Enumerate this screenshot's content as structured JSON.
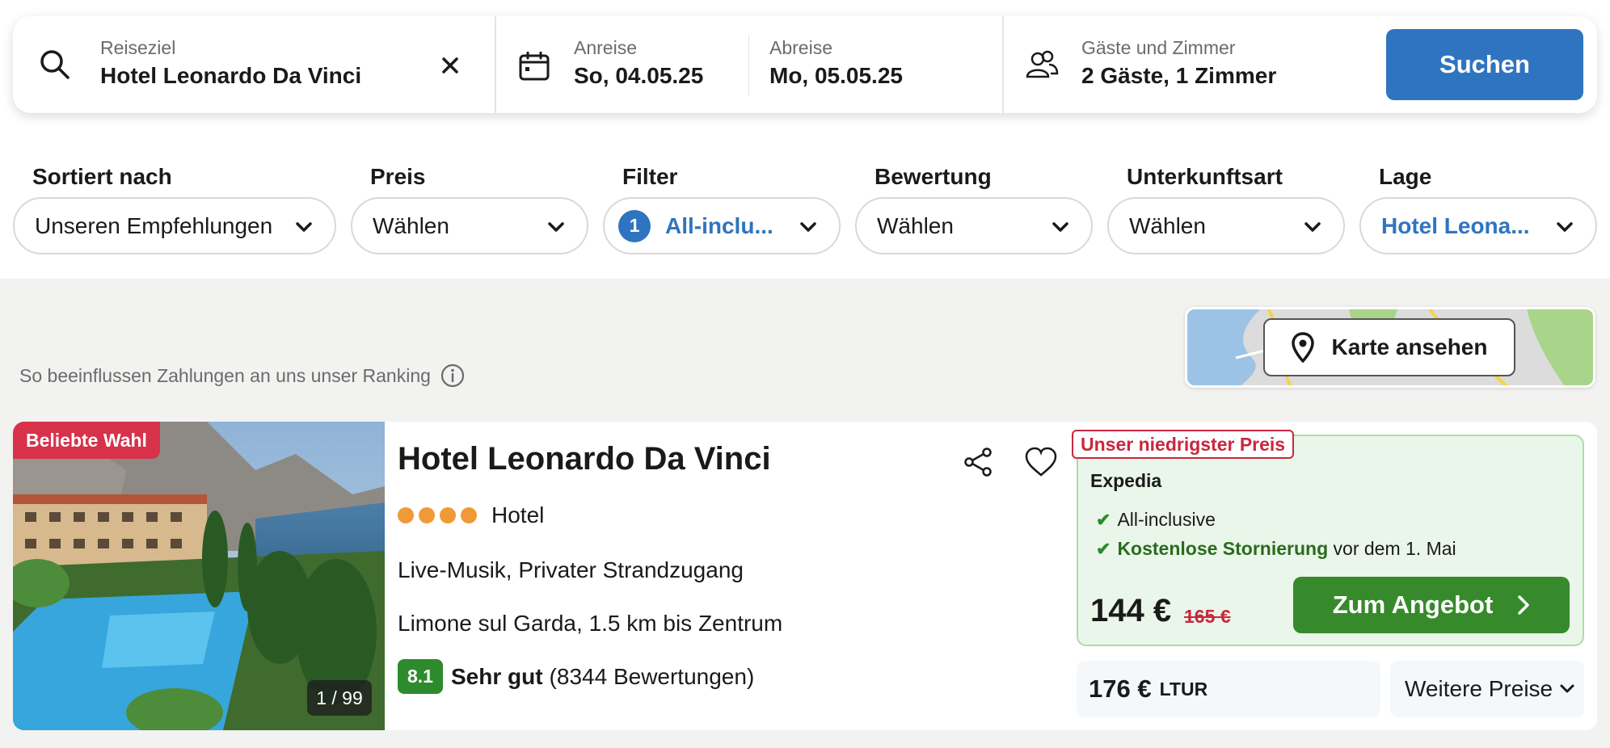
{
  "search": {
    "destination": {
      "label": "Reiseziel",
      "value": "Hotel Leonardo Da Vinci"
    },
    "checkin": {
      "label": "Anreise",
      "value": "So, 04.05.25"
    },
    "checkout": {
      "label": "Abreise",
      "value": "Mo, 05.05.25"
    },
    "guests": {
      "label": "Gäste und Zimmer",
      "value": "2 Gäste, 1 Zimmer"
    },
    "submit": "Suchen"
  },
  "filters": [
    {
      "label": "Sortiert nach",
      "value": "Unseren Empfehlungen"
    },
    {
      "label": "Preis",
      "value": "Wählen"
    },
    {
      "label": "Filter",
      "value": "All-inclu...",
      "count": "1"
    },
    {
      "label": "Bewertung",
      "value": "Wählen"
    },
    {
      "label": "Unterkunftsart",
      "value": "Wählen"
    },
    {
      "label": "Lage",
      "value": "Hotel Leona..."
    }
  ],
  "ranking_note": "So beeinflussen Zahlungen an uns unser Ranking",
  "map": {
    "button": "Karte ansehen"
  },
  "hotel": {
    "badge": "Beliebte Wahl",
    "photo_counter": "1 / 99",
    "name": "Hotel Leonardo Da Vinci",
    "stars": 4,
    "type": "Hotel",
    "features": "Live-Musik, Privater Strandzugang",
    "location": "Limone sul Garda, 1.5 km bis Zentrum",
    "rating": {
      "score": "8.1",
      "label": "Sehr gut",
      "count": "(8344 Bewertungen)"
    },
    "deal": {
      "tag": "Unser niedrigster Preis",
      "provider": "Expedia",
      "perk1": "All-inclusive",
      "perk2_bold": "Kostenlose Stornierung",
      "perk2_rest": " vor dem 1. Mai",
      "price": "144 €",
      "old_price": "165 €",
      "button": "Zum Angebot"
    },
    "alt_offer": {
      "price": "176 €",
      "provider": "LTUR"
    },
    "more_prices": "Weitere Preise"
  },
  "colors": {
    "primary": "#2f74c0",
    "offer_green": "#378a2b",
    "badge_red": "#d8324a",
    "star_orange": "#f09a37"
  }
}
